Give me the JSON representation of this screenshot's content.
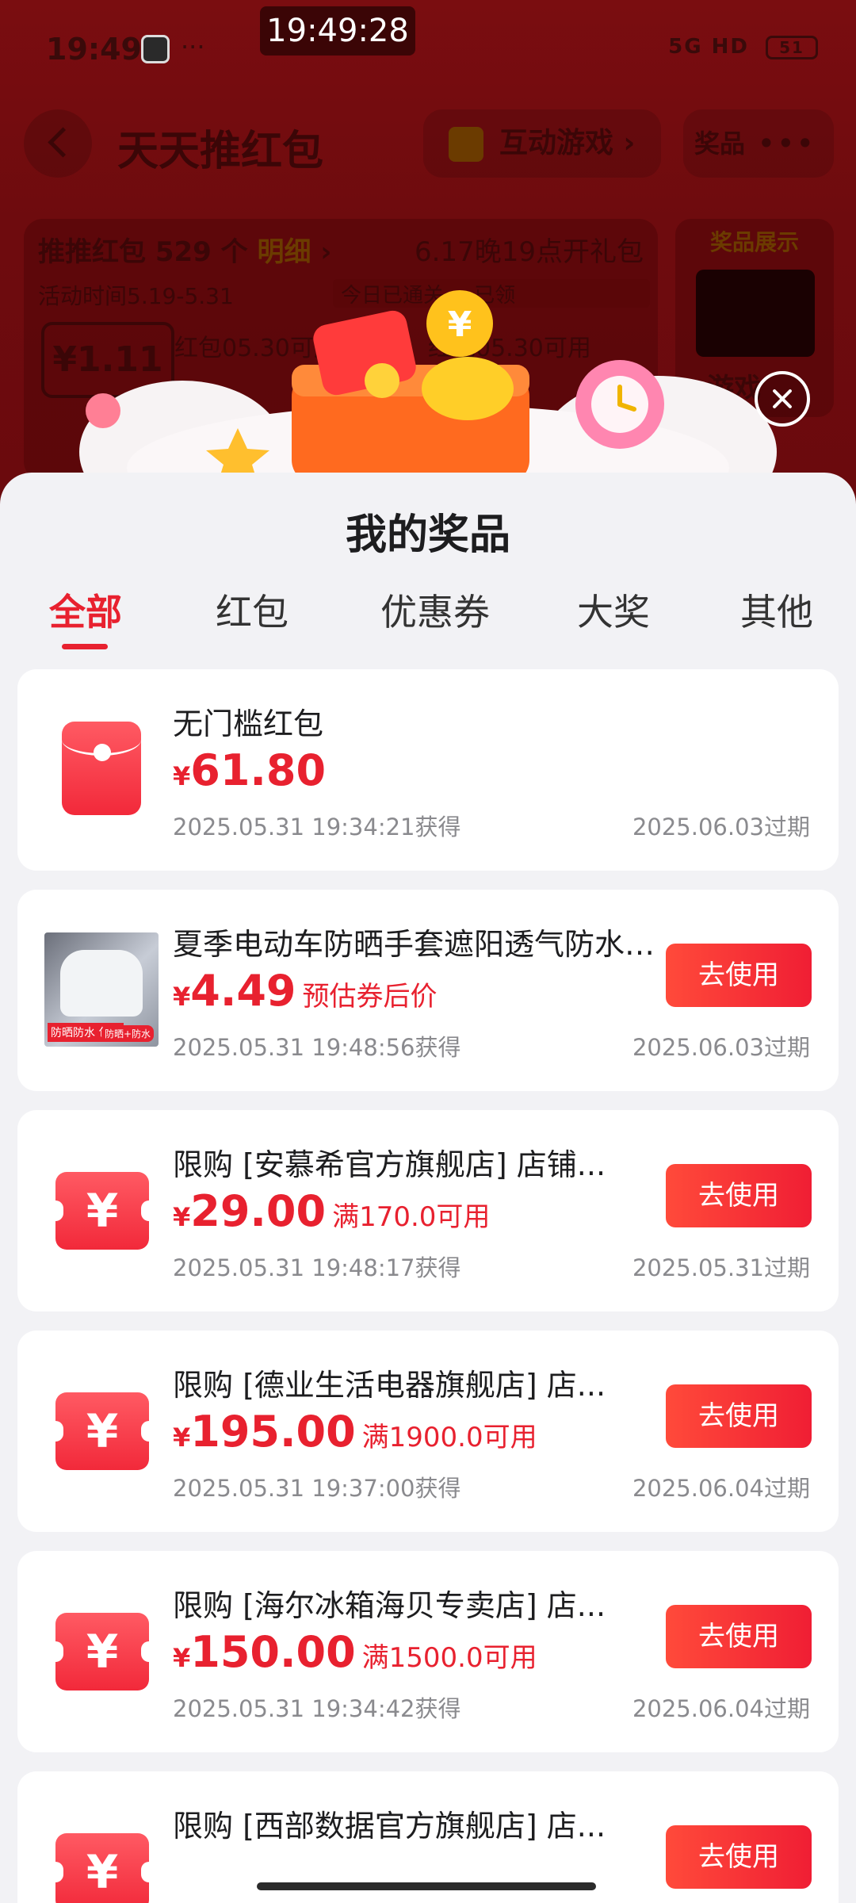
{
  "status_bar": {
    "time_left": "19:49",
    "time_center": "19:49:28",
    "dots": "···",
    "network": "5G HD",
    "battery": "51"
  },
  "background": {
    "title": "天天推红包",
    "game_button": "互动游戏",
    "prize_button": "奖品",
    "summary_prefix": "推推红包",
    "summary_count": "529",
    "summary_unit": "个",
    "summary_detail": "明细",
    "event_notice": "6.17晚19点开礼包",
    "activity_time": "活动时间5.19-5.31",
    "today_badge": "今日已通关",
    "claimed": "已领",
    "amount": "¥1.11",
    "coupon_text_1": "红包05.30可用",
    "coupon_text_2": "红包05.30可用",
    "side_title": "奖品展示",
    "side_label": "游戏"
  },
  "sheet": {
    "title": "我的奖品",
    "tabs": [
      {
        "label": "全部",
        "active": true
      },
      {
        "label": "红包",
        "active": false
      },
      {
        "label": "优惠券",
        "active": false
      },
      {
        "label": "大奖",
        "active": false
      },
      {
        "label": "其他",
        "active": false
      }
    ],
    "items": [
      {
        "icon": "red-packet-icon",
        "title": "无门槛红包",
        "yen": "¥",
        "amount": "61.80",
        "note": "",
        "obtained": "2025.05.31 19:34:21获得",
        "expire": "2025.06.03过期",
        "button": ""
      },
      {
        "icon": "product-thumbnail",
        "title": "夏季电动车防晒手套遮阳透气防水全包挡风",
        "yen": "¥",
        "amount": "4.49",
        "note": "预估券后价",
        "obtained": "2025.05.31 19:48:56获得",
        "expire": "2025.06.03过期",
        "button": "去使用",
        "thumb_tag_left": "防晒防水 包邮",
        "thumb_tag_right": "防晒+防水"
      },
      {
        "icon": "coupon-icon",
        "title": "限购 [安慕希官方旗舰店] 店铺...",
        "yen": "¥",
        "amount": "29.00",
        "note": "满170.0可用",
        "obtained": "2025.05.31 19:48:17获得",
        "expire": "2025.05.31过期",
        "button": "去使用"
      },
      {
        "icon": "coupon-icon",
        "title": "限购 [德业生活电器旗舰店] 店...",
        "yen": "¥",
        "amount": "195.00",
        "note": "满1900.0可用",
        "obtained": "2025.05.31 19:37:00获得",
        "expire": "2025.06.04过期",
        "button": "去使用"
      },
      {
        "icon": "coupon-icon",
        "title": "限购 [海尔冰箱海贝专卖店] 店...",
        "yen": "¥",
        "amount": "150.00",
        "note": "满1500.0可用",
        "obtained": "2025.05.31 19:34:42获得",
        "expire": "2025.06.04过期",
        "button": "去使用"
      },
      {
        "icon": "coupon-icon",
        "title": "限购 [西部数据官方旗舰店] 店...",
        "yen": "¥",
        "amount": "",
        "note": "",
        "obtained": "",
        "expire": "",
        "button": "去使用"
      }
    ],
    "ticket_symbol": "¥"
  },
  "colors": {
    "accent": "#e8212f",
    "sheet_bg": "#f2f2f5",
    "overlay_bg": "#6e0b0e"
  }
}
